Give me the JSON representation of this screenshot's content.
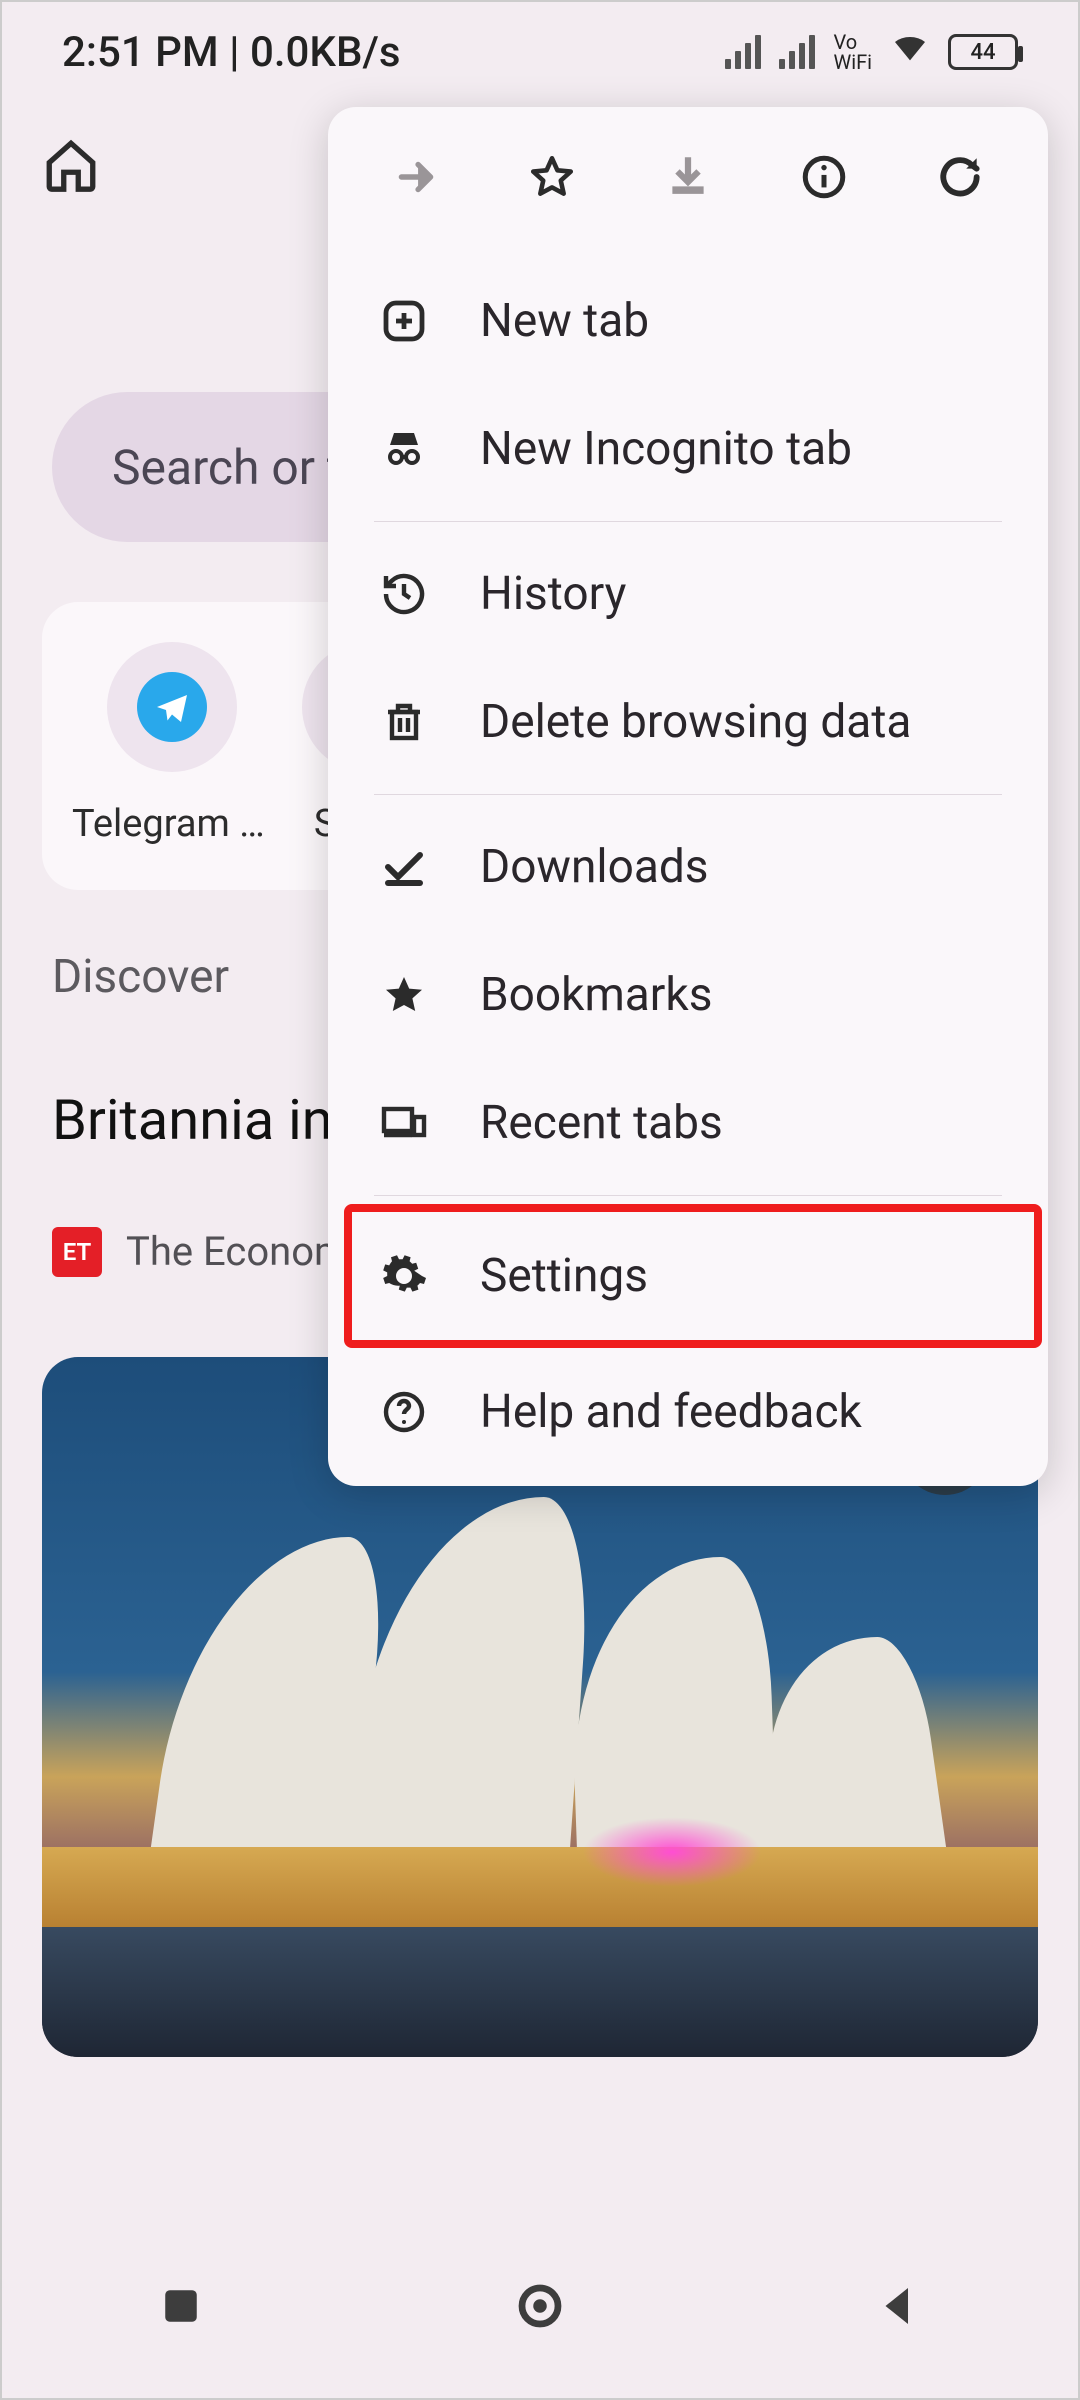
{
  "status": {
    "time": "2:51 PM",
    "separator": " | ",
    "net_speed": "0.0KB/s",
    "vowifi_top": "Vo",
    "vowifi_bot": "WiFi",
    "battery_level": "44"
  },
  "search_placeholder": "Search or type URL",
  "shortcuts": [
    {
      "label": "Telegram W…"
    },
    {
      "label": "Sto"
    }
  ],
  "discover_heading": "Discover",
  "article": {
    "title": "Britannia in talks with northeast's K…",
    "source": "The Economic Ti…",
    "source_badge": "ET"
  },
  "menu": {
    "items": [
      {
        "label": "New tab"
      },
      {
        "label": "New Incognito tab"
      },
      {
        "label": "History"
      },
      {
        "label": "Delete browsing data"
      },
      {
        "label": "Downloads"
      },
      {
        "label": "Bookmarks"
      },
      {
        "label": "Recent tabs"
      },
      {
        "label": "Settings"
      },
      {
        "label": "Help and feedback"
      }
    ],
    "highlighted_index": 7
  }
}
